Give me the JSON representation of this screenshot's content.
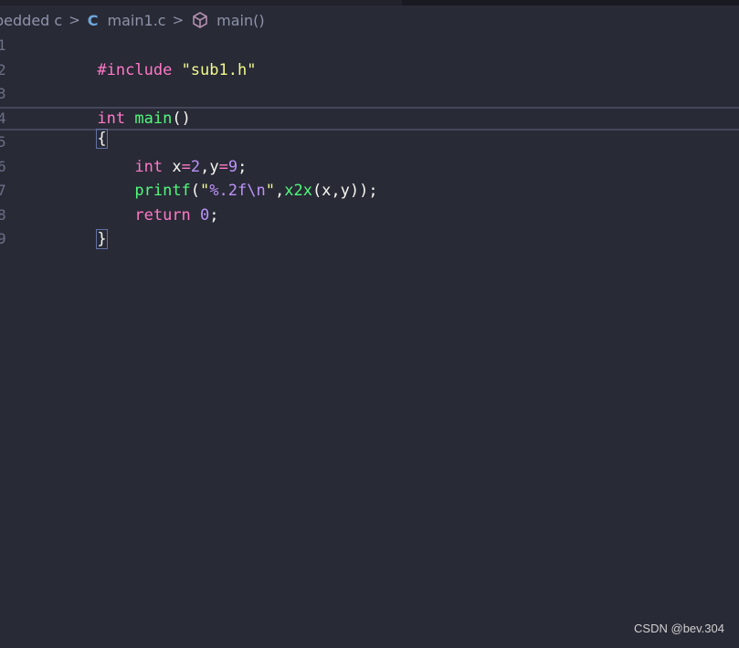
{
  "breadcrumb": {
    "folder": "bedded c",
    "file_icon": "C",
    "file": "main1.c",
    "symbol_icon": "cube-icon",
    "symbol": "main()",
    "separator": ">"
  },
  "editor": {
    "line_numbers": [
      "1",
      "2",
      "3",
      "4",
      "5",
      "6",
      "7",
      "8",
      "9"
    ],
    "lines": [
      {
        "tokens": [
          "#include",
          " ",
          "\"sub1.h\""
        ]
      },
      {
        "tokens": []
      },
      {
        "tokens": [
          "int",
          " ",
          "main",
          "()"
        ]
      },
      {
        "tokens": [
          "{"
        ]
      },
      {
        "tokens": [
          "    ",
          "int",
          " x",
          "=",
          "2",
          ",y",
          "=",
          "9",
          ";"
        ]
      },
      {
        "tokens": [
          "    ",
          "printf",
          "(",
          "\"",
          "%.2f\\n",
          "\"",
          ",",
          "x2x",
          "(x,y));"
        ]
      },
      {
        "tokens": [
          "    ",
          "return",
          " ",
          "0",
          ";"
        ]
      },
      {
        "tokens": [
          "}"
        ]
      },
      {
        "tokens": []
      }
    ]
  },
  "watermark": "CSDN @bev.304",
  "colors": {
    "background": "#282a36",
    "keyword": "#ff79c6",
    "string": "#f1fa8c",
    "function": "#50fa7b",
    "number": "#bd93f9",
    "text": "#f8f8f2",
    "line_number": "#6c7086",
    "breadcrumb_text": "#8f93a8",
    "c_icon": "#6fa8dc"
  }
}
